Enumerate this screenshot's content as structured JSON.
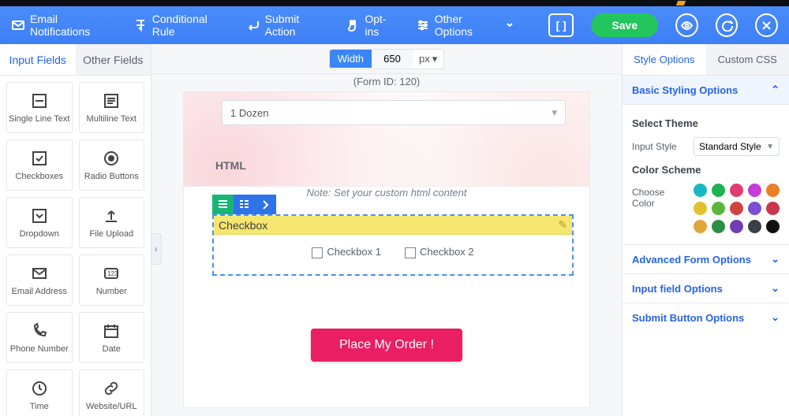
{
  "toolbar": {
    "email": "Email Notifications",
    "conditional": "Conditional Rule",
    "submit": "Submit Action",
    "optins": "Opt-ins",
    "other": "Other Options",
    "bracket": "[ ]",
    "save": "Save"
  },
  "left": {
    "tab_input": "Input Fields",
    "tab_other": "Other Fields",
    "items": [
      {
        "label": "Single Line Text"
      },
      {
        "label": "Multiline Text"
      },
      {
        "label": "Checkboxes"
      },
      {
        "label": "Radio Buttons"
      },
      {
        "label": "Dropdown"
      },
      {
        "label": "File Upload"
      },
      {
        "label": "Email Address"
      },
      {
        "label": "Number"
      },
      {
        "label": "Phone Number"
      },
      {
        "label": "Date"
      },
      {
        "label": "Time"
      },
      {
        "label": "Website/URL"
      }
    ]
  },
  "canvas": {
    "width_label": "Width",
    "width_value": "650",
    "width_unit": "px",
    "form_id": "(Form ID: 120)",
    "dropdown_value": "1 Dozen",
    "html_label": "HTML",
    "html_note": "Note: Set your custom html content",
    "block_title": "Checkbox",
    "cb1": "Checkbox 1",
    "cb2": "Checkbox 2",
    "submit_label": "Place My Order !"
  },
  "right": {
    "tab_style": "Style Options",
    "tab_css": "Custom CSS",
    "acc_basic": "Basic Styling Options",
    "theme_title": "Select Theme",
    "input_style_label": "Input Style",
    "input_style_value": "Standard Style",
    "color_title": "Color Scheme",
    "choose_color": "Choose Color",
    "swatches": [
      "#17b8c4",
      "#1fb254",
      "#e23b6d",
      "#c43bd6",
      "#ea7f23",
      "#e0c22d",
      "#5bb53a",
      "#d14343",
      "#7a4fd1",
      "#c7354e",
      "#e0a63a",
      "#2c8f46",
      "#6f3fb2",
      "#3b3f46",
      "#111"
    ],
    "acc_adv": "Advanced Form Options",
    "acc_input": "Input field Options",
    "acc_submit": "Submit Button Options"
  }
}
